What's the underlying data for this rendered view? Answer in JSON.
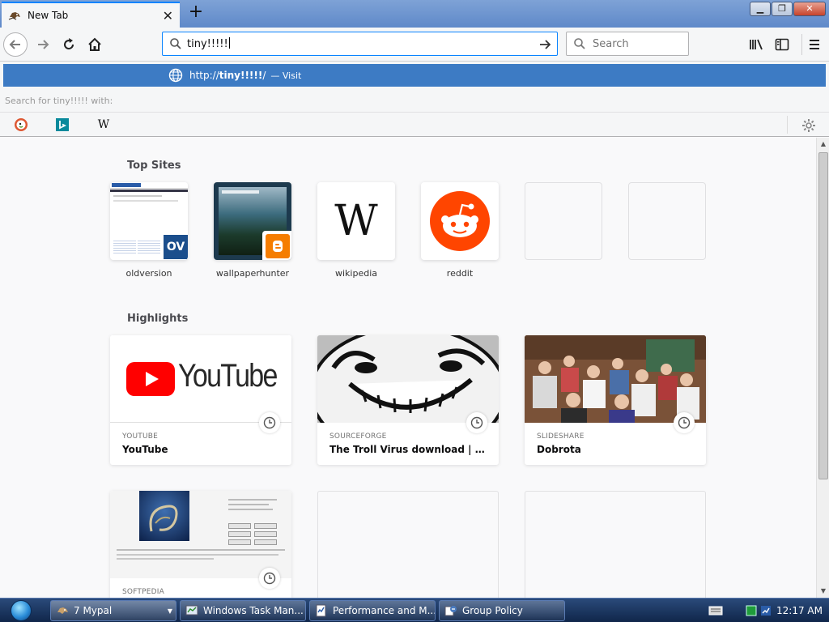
{
  "tab": {
    "title": "New Tab"
  },
  "urlbar": {
    "value": "tiny!!!!!"
  },
  "searchbar": {
    "placeholder": "Search"
  },
  "suggestion": {
    "url_prefix": "http://",
    "url_bold": "tiny!!!!!",
    "url_suffix": "/",
    "action": "— Visit"
  },
  "search_for": "Search for tiny!!!!! with:",
  "engines": [
    {
      "name": "duckduckgo-icon"
    },
    {
      "name": "bing-icon"
    },
    {
      "name": "wikipedia-icon",
      "glyph": "W"
    }
  ],
  "top_sites": {
    "heading": "Top Sites",
    "items": [
      {
        "label": "oldversion",
        "badge": "OV"
      },
      {
        "label": "wallpaperhunter"
      },
      {
        "label": "wikipedia",
        "glyph": "W"
      },
      {
        "label": "reddit"
      },
      {
        "label": ""
      },
      {
        "label": ""
      }
    ]
  },
  "highlights": {
    "heading": "Highlights",
    "items": [
      {
        "source": "YOUTUBE",
        "title": "YouTube",
        "logo_text": "YouTube"
      },
      {
        "source": "SOURCEFORGE",
        "title": "The Troll Virus download | SourceForge.net"
      },
      {
        "source": "SLIDESHARE",
        "title": "Dobrota"
      },
      {
        "source": "SOFTPEDIA",
        "title": ""
      }
    ]
  },
  "taskbar": {
    "items": [
      {
        "label": "7 Mypal"
      },
      {
        "label": "Windows Task Man..."
      },
      {
        "label": "Performance and M..."
      },
      {
        "label": "Group Policy"
      }
    ],
    "clock": "12:17 AM"
  },
  "colors": {
    "accent": "#0a84ff",
    "suggest_bg": "#3d7bc4",
    "reddit": "#ff4500",
    "youtube": "#ff0000",
    "blogger": "#f57d00"
  }
}
